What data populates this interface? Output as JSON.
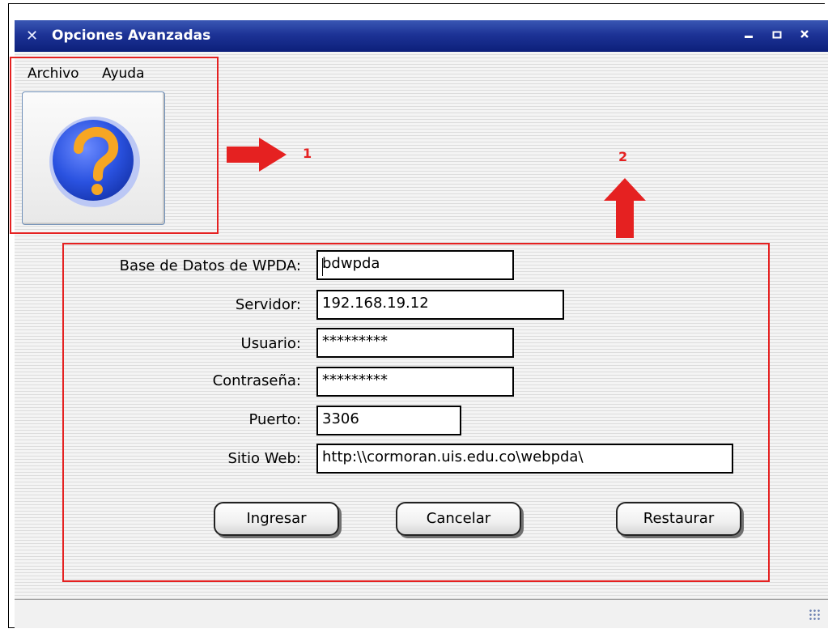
{
  "window": {
    "title": "Opciones Avanzadas",
    "app_icon_glyph": "✕"
  },
  "menu": {
    "items": [
      "Archivo",
      "Ayuda"
    ]
  },
  "toolbar": {
    "help_button_icon": "help-question-icon"
  },
  "annotations": {
    "label_1": "1",
    "label_2": "2"
  },
  "form": {
    "fields": [
      {
        "label": "Base de Datos de WPDA:",
        "value": "bdwpda"
      },
      {
        "label": "Servidor:",
        "value": "192.168.19.12"
      },
      {
        "label": "Usuario:",
        "value": "*********"
      },
      {
        "label": "Contraseña:",
        "value": "*********"
      },
      {
        "label": "Puerto:",
        "value": "3306"
      },
      {
        "label": "Sitio Web:",
        "value": "http:\\\\cormoran.uis.edu.co\\webpda\\"
      }
    ],
    "buttons": {
      "ingresar": "Ingresar",
      "cancelar": "Cancelar",
      "restaurar": "Restaurar"
    }
  },
  "colors": {
    "titlebar": "#1d3396",
    "annotation": "#e52121",
    "help_icon_blue": "#2a52e0",
    "help_icon_orange": "#f6a623"
  }
}
